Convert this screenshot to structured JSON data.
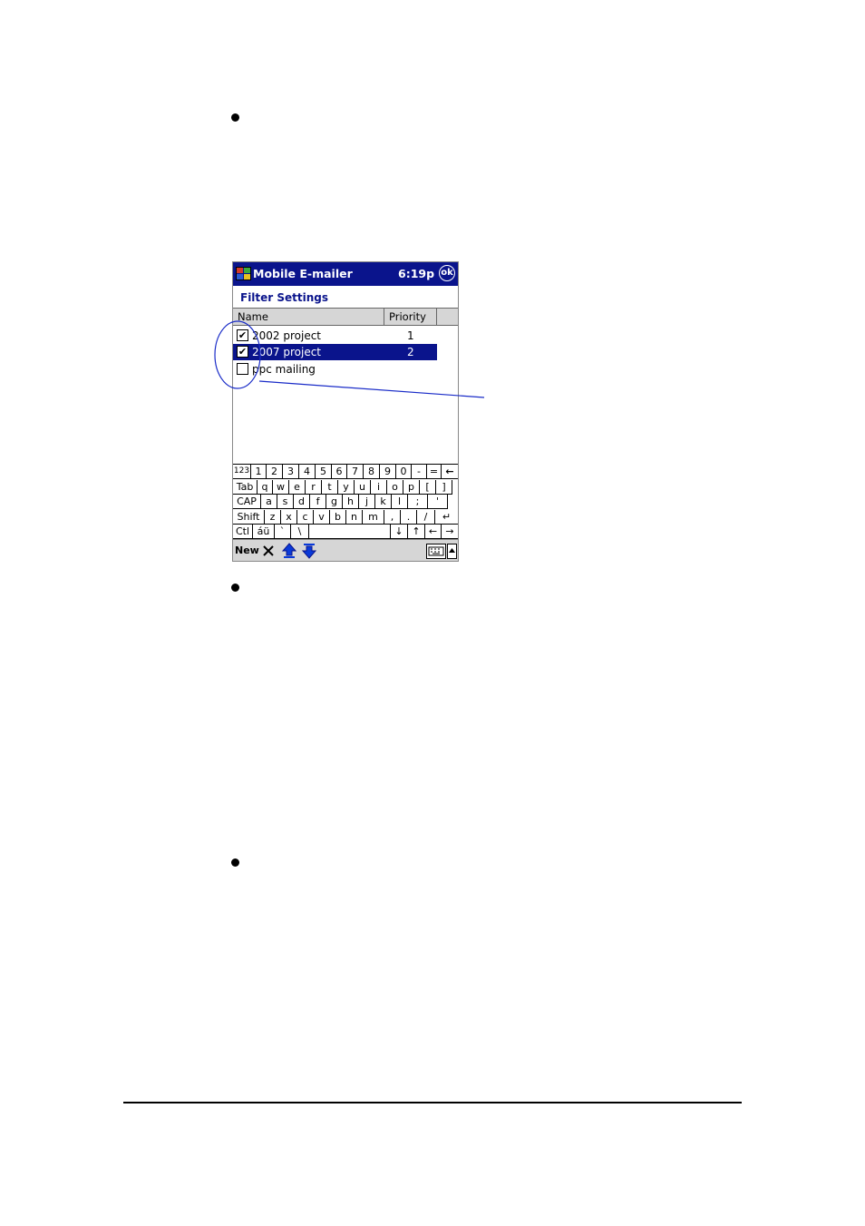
{
  "device": {
    "title": "Mobile E-mailer",
    "clock": "6:19p",
    "ok_label": "ok",
    "heading": "Filter Settings",
    "columns": [
      "Name",
      "Priority"
    ],
    "filters": [
      {
        "name": "2002 project",
        "priority": "1",
        "checked": true,
        "selected": false
      },
      {
        "name": "2007 project",
        "priority": "2",
        "checked": true,
        "selected": true
      },
      {
        "name": "ppc mailing",
        "priority": "",
        "checked": false,
        "selected": false
      }
    ],
    "keyboard": {
      "row1": [
        "123",
        "1",
        "2",
        "3",
        "4",
        "5",
        "6",
        "7",
        "8",
        "9",
        "0",
        "-",
        "=",
        "←"
      ],
      "row2": [
        "Tab",
        "q",
        "w",
        "e",
        "r",
        "t",
        "y",
        "u",
        "i",
        "o",
        "p",
        "[",
        "]"
      ],
      "row3": [
        "CAP",
        "a",
        "s",
        "d",
        "f",
        "g",
        "h",
        "j",
        "k",
        "l",
        ";",
        "'"
      ],
      "row4": [
        "Shift",
        "z",
        "x",
        "c",
        "v",
        "b",
        "n",
        "m",
        ",",
        ".",
        "/",
        "↵"
      ],
      "row5": [
        "Ctl",
        "áü",
        "`",
        "\\",
        "",
        "↓",
        "↑",
        "←",
        "→"
      ]
    },
    "menu": {
      "new_label": "New",
      "delete_icon": "x-delete-icon",
      "move_up_icon": "up-arrow-icon",
      "move_down_icon": "down-arrow-icon",
      "keyboard_icon": "keyboard-icon"
    }
  },
  "colors": {
    "title_bar": "#0a148c",
    "selection": "#0a148c",
    "annotation": "#1a2cc8"
  }
}
